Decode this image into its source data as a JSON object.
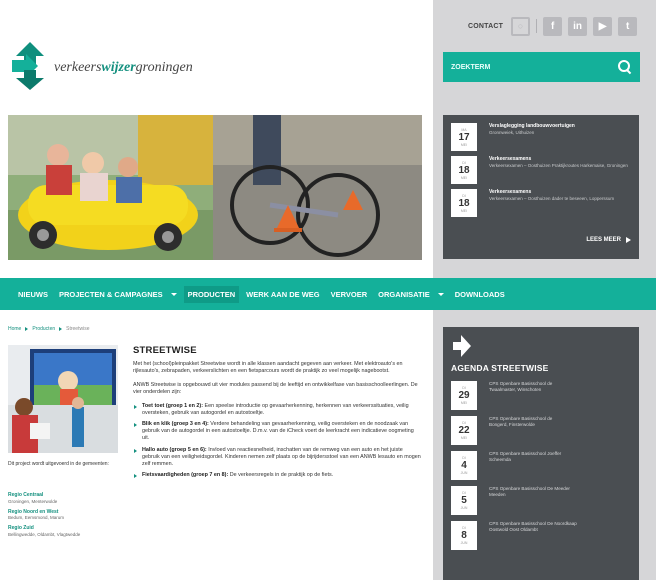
{
  "header": {
    "contact_label": "CONTACT",
    "social_icons": [
      "circle-icon",
      "facebook-icon",
      "linkedin-icon",
      "youtube-icon",
      "twitter-icon"
    ],
    "search_placeholder": "ZOEKTERM"
  },
  "logo": {
    "part1": "verkeers",
    "part2": "wijzer",
    "part3": "groningen"
  },
  "news": {
    "items": [
      {
        "weekday": "MA",
        "day": "17",
        "month": "MEI",
        "title": "Verslaglegging landbouwvoertuigen",
        "subtitle": "Gronnweiek, Uithuizen"
      },
      {
        "weekday": "DI",
        "day": "18",
        "month": "MEI",
        "title": "Verkeersexamens",
        "subtitle": "Verkeersexamen – Oosthuizen Praktijkroutes Harkemaise, Groningen"
      },
      {
        "weekday": "DI",
        "day": "18",
        "month": "MEI",
        "title": "Verkeersexamens",
        "subtitle": "Verkeersexamen – Oosthuizen dader te beseeen, Lopperssum"
      }
    ],
    "more_label": "LEES MEER"
  },
  "nav": {
    "items": [
      {
        "label": "NIEUWS",
        "dropdown": false,
        "active": false
      },
      {
        "label": "PROJECTEN & CAMPAGNES",
        "dropdown": true,
        "active": false
      },
      {
        "label": "PRODUCTEN",
        "dropdown": false,
        "active": true
      },
      {
        "label": "WERK AAN DE WEG",
        "dropdown": false,
        "active": false
      },
      {
        "label": "VERVOER",
        "dropdown": false,
        "active": false
      },
      {
        "label": "ORGANISATIE",
        "dropdown": true,
        "active": false
      },
      {
        "label": "DOWNLOADS",
        "dropdown": false,
        "active": false
      }
    ]
  },
  "breadcrumb": {
    "home": "Home",
    "level1": "Producten",
    "current": "Streetwise"
  },
  "sidebar": {
    "caption": "Dit project wordt uitgevoerd in de gemeenten:",
    "regions": [
      {
        "name": "Regio Centraal",
        "desc": "Groningen, Menterwolde"
      },
      {
        "name": "Regio Noord en West",
        "desc": "Bedum, Eemsmond, Marum"
      },
      {
        "name": "Regio Zuid",
        "desc": "Bellingwedde, Oldambt, Vlagtwedde"
      }
    ]
  },
  "article": {
    "title": "STREETWISE",
    "p1": "Met het (school)pleinpakket Streetwise wordt in alle klassen aandacht gegeven aan verkeer. Met elektroauto's en rijlesauto's, zebrapaden, verkeerslichten en een fietsparcours wordt de praktijk zo veel mogelijk nagebootst.",
    "p2": "ANWB Streetwise is opgebouwd uit vier modules passend bij de leeftijd en ontwikkelfase van basisschoolleerlingen. De vier onderdelen zijn:",
    "items": [
      {
        "label": "Toet toet (groep 1 en 2):",
        "text": " Een speelse introductie op gevaarherkenning, herkennen van verkeerssituaties, veilig oversteken, gebruik van autogordel en autostoeltje."
      },
      {
        "label": "Blik en klik (groep 3 en 4):",
        "text": " Verdere behandeling van gevaarherkenning, veilig oversteken en de noodzaak van gebruik van de autogordel in een autostoeltje. D.m.v. van de iCheck voert de leerkracht een indicatieve oogmeting uit."
      },
      {
        "label": "Hallo auto (groep 5 en 6):",
        "text": " Invloed van reactiesnelheid, inschatten van de remweg van een auto en het juiste gebruik van een veiligheidsgordel. Kinderen nemen zelf plaats op de bijrijdersstoel van een ANWB lesauto en mogen zelf remmen."
      },
      {
        "label": "Fietsvaardigheden (groep 7 en 8):",
        "text": " De verkeersregels in de praktijk op de fiets."
      }
    ]
  },
  "agenda": {
    "title": "AGENDA STREETWISE",
    "items": [
      {
        "weekday": "DI",
        "day": "29",
        "month": "MEI",
        "line1": "CPS Openbare Basisschool de",
        "line2": "Twaalmaster, Winschoten"
      },
      {
        "weekday": "DI",
        "day": "22",
        "month": "MEI",
        "line1": "CPS Openbare Basisschool de",
        "line2": "Bongerd, Finsterwolde"
      },
      {
        "weekday": "DI",
        "day": "4",
        "month": "JUN",
        "line1": "CPS Openbare Basisschool Joeffer",
        "line2": "Scheemda"
      },
      {
        "weekday": "DI",
        "day": "5",
        "month": "JUN",
        "line1": "CPS Openbare Basisschool De Meeder",
        "line2": "Meeden"
      },
      {
        "weekday": "DI",
        "day": "8",
        "month": "JUN",
        "line1": "CPS Openbare Basisschool De Noordkaap",
        "line2": "Oostwold Oost Oldambt"
      }
    ]
  },
  "colors": {
    "teal": "#14b09a",
    "dark_panel": "#4a4e52",
    "grey_column": "#d6d6d8"
  }
}
